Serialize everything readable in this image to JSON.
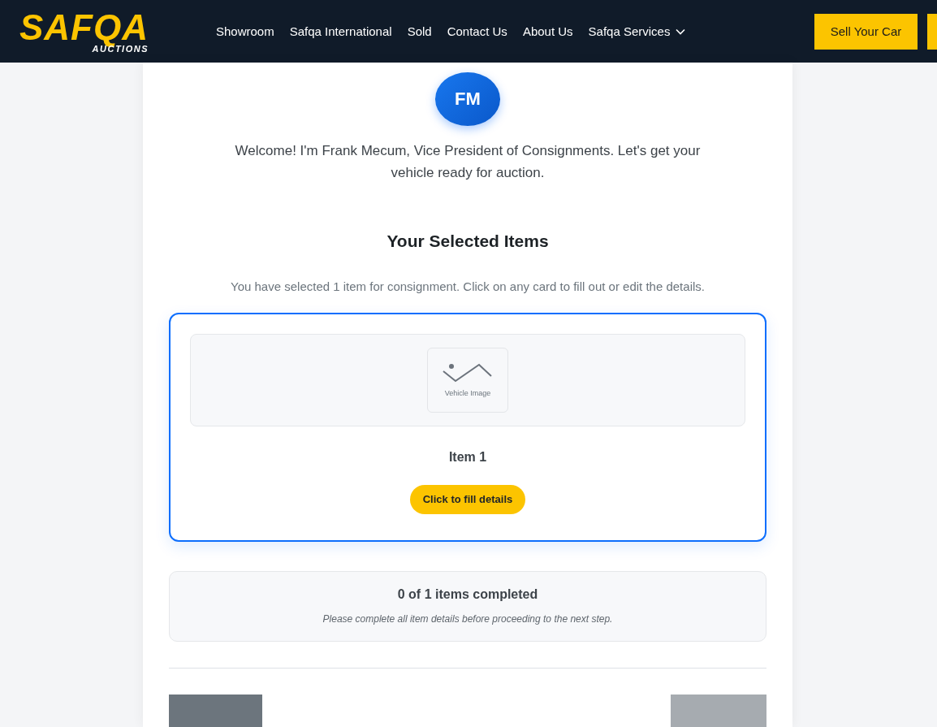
{
  "header": {
    "logo": {
      "title": "SAFQA",
      "subtitle": "AUCTIONS"
    },
    "nav": [
      {
        "label": "Showroom",
        "kind": "link"
      },
      {
        "label": "Safqa International",
        "kind": "link"
      },
      {
        "label": "Sold",
        "kind": "link"
      },
      {
        "label": "Contact Us",
        "kind": "link"
      },
      {
        "label": "About Us",
        "kind": "link"
      },
      {
        "label": "Safqa Services",
        "kind": "dropdown"
      }
    ],
    "buttons": [
      {
        "label": "Sell Your Car"
      },
      {
        "kind": "cut"
      }
    ]
  },
  "host": {
    "initials": "FM",
    "message": "Welcome! I'm Frank Mecum, Vice President of Consignments. Let's get your vehicle ready for auction."
  },
  "section": {
    "title": "Your Selected Items",
    "subtitle": "You have selected 1 item for consignment. Click on any card to fill out or edit the details."
  },
  "items": [
    {
      "name": "Item 1",
      "image_label": "Vehicle Image",
      "action": "Click to fill details",
      "selected": true
    }
  ],
  "progress": {
    "summary": "0 of 1 items completed",
    "note": "Please complete all item details before proceeding to the next step."
  },
  "footer_buttons": [
    {
      "kind": "back"
    },
    {
      "kind": "next",
      "disabled": true
    }
  ]
}
